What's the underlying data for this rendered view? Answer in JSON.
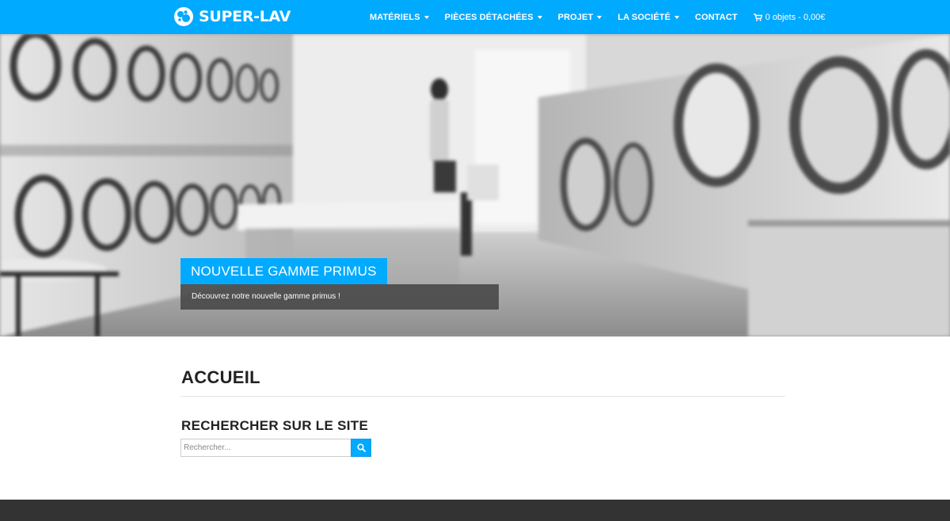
{
  "brand": {
    "name": "SUPER-LAV",
    "logo_icon": "bubbles-logo-icon"
  },
  "colors": {
    "accent": "#00aaff",
    "footer": "#333333",
    "text": "#222222"
  },
  "nav": {
    "items": [
      {
        "label": "MATÉRIELS",
        "has_dropdown": true
      },
      {
        "label": "PIÈCES DÉTACHÉES",
        "has_dropdown": true
      },
      {
        "label": "PROJET",
        "has_dropdown": true
      },
      {
        "label": "LA SOCIÉTÉ",
        "has_dropdown": true
      },
      {
        "label": "CONTACT",
        "has_dropdown": false
      }
    ],
    "cart": {
      "icon": "shopping-cart-icon",
      "label": "0 objets - 0,00€"
    }
  },
  "hero": {
    "slide_title": "NOUVELLE GAMME PRIMUS",
    "slide_caption": "Découvrez notre nouvelle gamme primus !"
  },
  "main": {
    "page_title": "ACCUEIL",
    "search": {
      "title": "RECHERCHER SUR LE SITE",
      "placeholder": "Rechercher...",
      "value": "",
      "button_icon": "search-icon"
    }
  }
}
